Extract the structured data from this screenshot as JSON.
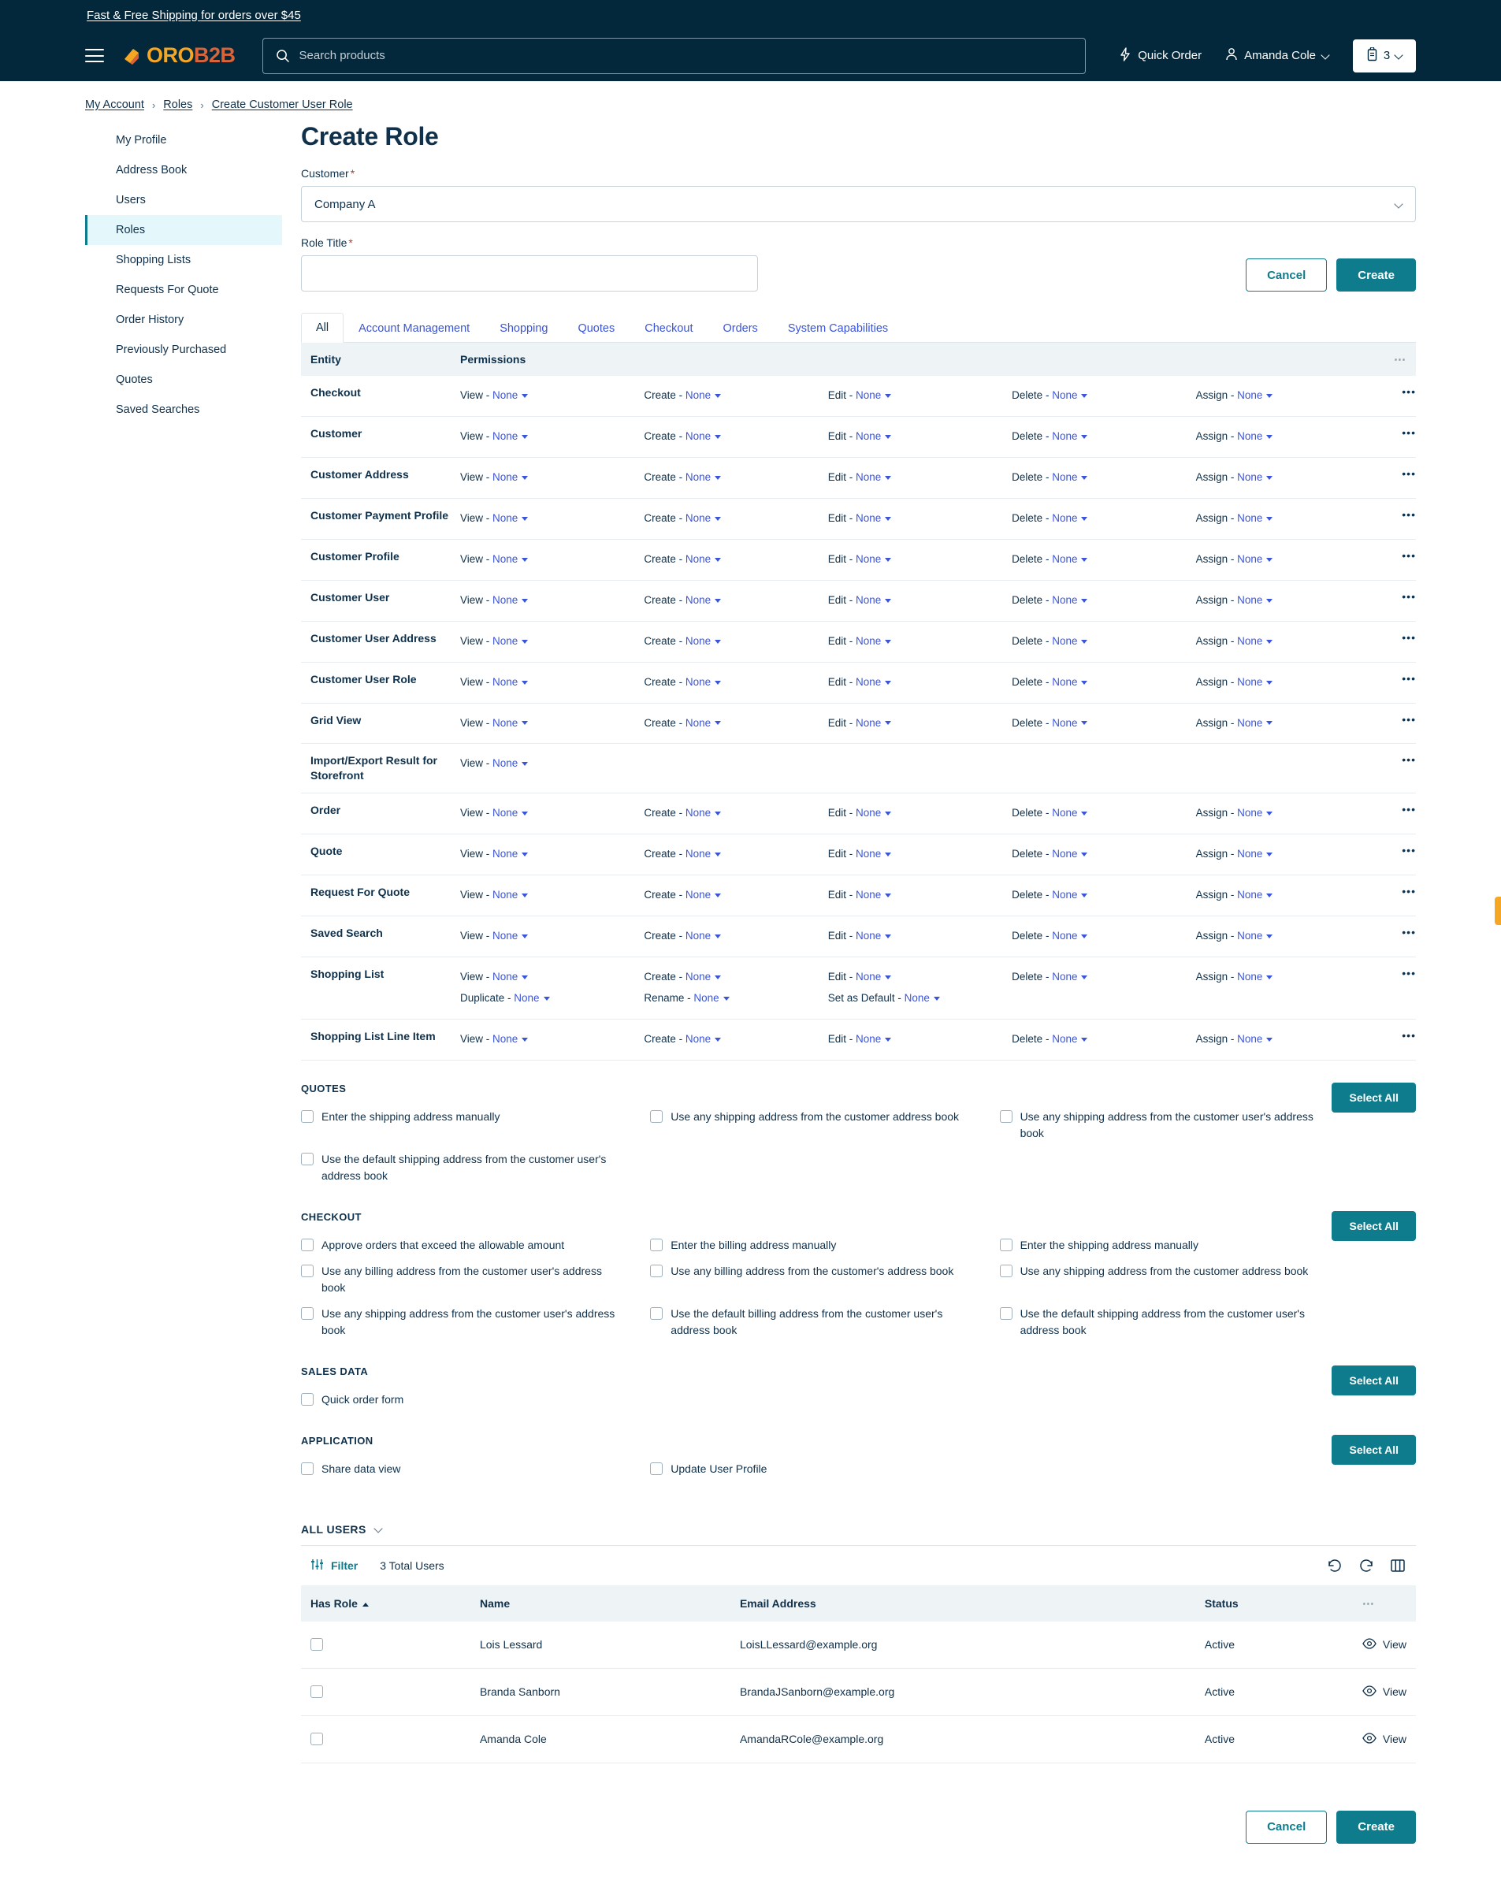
{
  "promo": {
    "text": "Fast & Free Shipping for orders over $45"
  },
  "header": {
    "logo": {
      "oro": "ORO",
      "b2b": "B2B"
    },
    "search": {
      "placeholder": "Search products",
      "value": ""
    },
    "quick_order": "Quick Order",
    "account_name": "Amanda Cole",
    "cart_count": "3"
  },
  "breadcrumb": [
    {
      "label": "My Account"
    },
    {
      "label": "Roles"
    },
    {
      "label": "Create Customer User Role"
    }
  ],
  "sidebar": {
    "items": [
      {
        "label": "My Profile",
        "active": false
      },
      {
        "label": "Address Book",
        "active": false
      },
      {
        "label": "Users",
        "active": false
      },
      {
        "label": "Roles",
        "active": true
      },
      {
        "label": "Shopping Lists",
        "active": false
      },
      {
        "label": "Requests For Quote",
        "active": false
      },
      {
        "label": "Order History",
        "active": false
      },
      {
        "label": "Previously Purchased",
        "active": false
      },
      {
        "label": "Quotes",
        "active": false
      },
      {
        "label": "Saved Searches",
        "active": false
      }
    ]
  },
  "main": {
    "title": "Create Role",
    "customer_label": "Customer",
    "customer_value": "Company A",
    "role_title_label": "Role Title",
    "role_title_value": "",
    "cancel_label": "Cancel",
    "create_label": "Create"
  },
  "tabs": [
    {
      "label": "All",
      "active": true
    },
    {
      "label": "Account Management",
      "active": false
    },
    {
      "label": "Shopping",
      "active": false
    },
    {
      "label": "Quotes",
      "active": false
    },
    {
      "label": "Checkout",
      "active": false
    },
    {
      "label": "Orders",
      "active": false
    },
    {
      "label": "System Capabilities",
      "active": false
    }
  ],
  "permissions_table": {
    "columns": [
      "Entity",
      "Permissions"
    ],
    "rows": [
      {
        "entity": "Checkout",
        "perms": [
          {
            "action": "View",
            "value": "None"
          },
          {
            "action": "Create",
            "value": "None"
          },
          {
            "action": "Edit",
            "value": "None"
          },
          {
            "action": "Delete",
            "value": "None"
          },
          {
            "action": "Assign",
            "value": "None"
          }
        ]
      },
      {
        "entity": "Customer",
        "perms": [
          {
            "action": "View",
            "value": "None"
          },
          {
            "action": "Create",
            "value": "None"
          },
          {
            "action": "Edit",
            "value": "None"
          },
          {
            "action": "Delete",
            "value": "None"
          },
          {
            "action": "Assign",
            "value": "None"
          }
        ]
      },
      {
        "entity": "Customer Address",
        "perms": [
          {
            "action": "View",
            "value": "None"
          },
          {
            "action": "Create",
            "value": "None"
          },
          {
            "action": "Edit",
            "value": "None"
          },
          {
            "action": "Delete",
            "value": "None"
          },
          {
            "action": "Assign",
            "value": "None"
          }
        ]
      },
      {
        "entity": "Customer Payment Profile",
        "perms": [
          {
            "action": "View",
            "value": "None"
          },
          {
            "action": "Create",
            "value": "None"
          },
          {
            "action": "Edit",
            "value": "None"
          },
          {
            "action": "Delete",
            "value": "None"
          },
          {
            "action": "Assign",
            "value": "None"
          }
        ]
      },
      {
        "entity": "Customer Profile",
        "perms": [
          {
            "action": "View",
            "value": "None"
          },
          {
            "action": "Create",
            "value": "None"
          },
          {
            "action": "Edit",
            "value": "None"
          },
          {
            "action": "Delete",
            "value": "None"
          },
          {
            "action": "Assign",
            "value": "None"
          }
        ]
      },
      {
        "entity": "Customer User",
        "perms": [
          {
            "action": "View",
            "value": "None"
          },
          {
            "action": "Create",
            "value": "None"
          },
          {
            "action": "Edit",
            "value": "None"
          },
          {
            "action": "Delete",
            "value": "None"
          },
          {
            "action": "Assign",
            "value": "None"
          }
        ]
      },
      {
        "entity": "Customer User Address",
        "perms": [
          {
            "action": "View",
            "value": "None"
          },
          {
            "action": "Create",
            "value": "None"
          },
          {
            "action": "Edit",
            "value": "None"
          },
          {
            "action": "Delete",
            "value": "None"
          },
          {
            "action": "Assign",
            "value": "None"
          }
        ]
      },
      {
        "entity": "Customer User Role",
        "perms": [
          {
            "action": "View",
            "value": "None"
          },
          {
            "action": "Create",
            "value": "None"
          },
          {
            "action": "Edit",
            "value": "None"
          },
          {
            "action": "Delete",
            "value": "None"
          },
          {
            "action": "Assign",
            "value": "None"
          }
        ]
      },
      {
        "entity": "Grid View",
        "perms": [
          {
            "action": "View",
            "value": "None"
          },
          {
            "action": "Create",
            "value": "None"
          },
          {
            "action": "Edit",
            "value": "None"
          },
          {
            "action": "Delete",
            "value": "None"
          },
          {
            "action": "Assign",
            "value": "None"
          }
        ]
      },
      {
        "entity": "Import/Export Result for Storefront",
        "perms": [
          {
            "action": "View",
            "value": "None"
          }
        ]
      },
      {
        "entity": "Order",
        "perms": [
          {
            "action": "View",
            "value": "None"
          },
          {
            "action": "Create",
            "value": "None"
          },
          {
            "action": "Edit",
            "value": "None"
          },
          {
            "action": "Delete",
            "value": "None"
          },
          {
            "action": "Assign",
            "value": "None"
          }
        ]
      },
      {
        "entity": "Quote",
        "perms": [
          {
            "action": "View",
            "value": "None"
          },
          {
            "action": "Create",
            "value": "None"
          },
          {
            "action": "Edit",
            "value": "None"
          },
          {
            "action": "Delete",
            "value": "None"
          },
          {
            "action": "Assign",
            "value": "None"
          }
        ]
      },
      {
        "entity": "Request For Quote",
        "perms": [
          {
            "action": "View",
            "value": "None"
          },
          {
            "action": "Create",
            "value": "None"
          },
          {
            "action": "Edit",
            "value": "None"
          },
          {
            "action": "Delete",
            "value": "None"
          },
          {
            "action": "Assign",
            "value": "None"
          }
        ]
      },
      {
        "entity": "Saved Search",
        "perms": [
          {
            "action": "View",
            "value": "None"
          },
          {
            "action": "Create",
            "value": "None"
          },
          {
            "action": "Edit",
            "value": "None"
          },
          {
            "action": "Delete",
            "value": "None"
          },
          {
            "action": "Assign",
            "value": "None"
          }
        ]
      },
      {
        "entity": "Shopping List",
        "perms": [
          {
            "action": "View",
            "value": "None"
          },
          {
            "action": "Create",
            "value": "None"
          },
          {
            "action": "Edit",
            "value": "None"
          },
          {
            "action": "Delete",
            "value": "None"
          },
          {
            "action": "Assign",
            "value": "None"
          },
          {
            "action": "Duplicate",
            "value": "None"
          },
          {
            "action": "Rename",
            "value": "None"
          },
          {
            "action": "Set as Default",
            "value": "None"
          }
        ]
      },
      {
        "entity": "Shopping List Line Item",
        "perms": [
          {
            "action": "View",
            "value": "None"
          },
          {
            "action": "Create",
            "value": "None"
          },
          {
            "action": "Edit",
            "value": "None"
          },
          {
            "action": "Delete",
            "value": "None"
          },
          {
            "action": "Assign",
            "value": "None"
          }
        ]
      }
    ]
  },
  "capability_sections": [
    {
      "heading": "QUOTES",
      "select_all": "Select All",
      "items": [
        {
          "label": "Enter the shipping address manually",
          "checked": false
        },
        {
          "label": "Use any shipping address from the customer address book",
          "checked": false
        },
        {
          "label": "Use any shipping address from the customer user's address book",
          "checked": false
        },
        {
          "label": "Use the default shipping address from the customer user's address book",
          "checked": false
        }
      ]
    },
    {
      "heading": "CHECKOUT",
      "select_all": "Select All",
      "items": [
        {
          "label": "Approve orders that exceed the allowable amount",
          "checked": false
        },
        {
          "label": "Enter the billing address manually",
          "checked": false
        },
        {
          "label": "Enter the shipping address manually",
          "checked": false
        },
        {
          "label": "Use any billing address from the customer user's address book",
          "checked": false
        },
        {
          "label": "Use any billing address from the customer's address book",
          "checked": false
        },
        {
          "label": "Use any shipping address from the customer address book",
          "checked": false
        },
        {
          "label": "Use any shipping address from the customer user's address book",
          "checked": false
        },
        {
          "label": "Use the default billing address from the customer user's address book",
          "checked": false
        },
        {
          "label": "Use the default shipping address from the customer user's address book",
          "checked": false
        }
      ]
    },
    {
      "heading": "SALES DATA",
      "select_all": "Select All",
      "items": [
        {
          "label": "Quick order form",
          "checked": false
        }
      ]
    },
    {
      "heading": "APPLICATION",
      "select_all": "Select All",
      "items": [
        {
          "label": "Share data view",
          "checked": false
        },
        {
          "label": "Update User Profile",
          "checked": false
        }
      ]
    }
  ],
  "users_grid": {
    "heading": "ALL USERS",
    "filter_label": "Filter",
    "total_text": "3 Total Users",
    "columns": [
      "Has Role",
      "Name",
      "Email Address",
      "Status"
    ],
    "sort_column": "Has Role",
    "sort_direction": "asc",
    "view_label": "View",
    "rows": [
      {
        "checked": false,
        "name": "Lois Lessard",
        "email": "LoisLLessard@example.org",
        "status": "Active",
        "action": "View"
      },
      {
        "checked": false,
        "name": "Branda Sanborn",
        "email": "BrandaJSanborn@example.org",
        "status": "Active",
        "action": "View"
      },
      {
        "checked": false,
        "name": "Amanda Cole",
        "email": "AmandaRCole@example.org",
        "status": "Active",
        "action": "View"
      }
    ]
  },
  "footer": {
    "cancel_label": "Cancel",
    "create_label": "Create"
  },
  "colors": {
    "header_bg": "#04283b",
    "accent": "#0e7c8d",
    "link": "#3b55d9",
    "brand_orange": "#f5a623",
    "brand_red": "#d9643a",
    "active_nav_bg": "#e4f7fa"
  }
}
